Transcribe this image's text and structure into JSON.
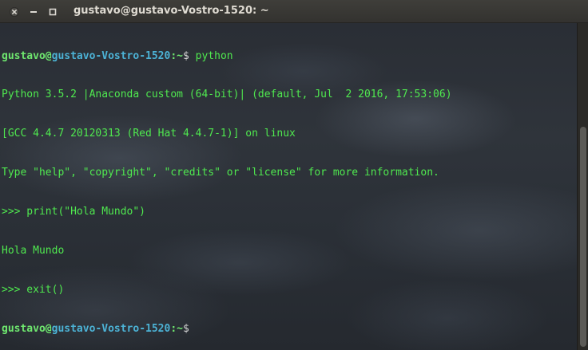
{
  "window": {
    "title": "gustavo@gustavo-Vostro-1520: ~"
  },
  "icons": {
    "close": "close-icon",
    "minimize": "minimize-icon",
    "maximize": "maximize-icon"
  },
  "colors": {
    "output_green": "#4fe84f",
    "prompt_green": "#6fe86f",
    "prompt_host_blue": "#4cb3d6",
    "titlebar_bg": "#3c3b37"
  },
  "terminal": {
    "prompt1": {
      "user": "gustavo",
      "at": "@",
      "host": "gustavo-Vostro-1520",
      "path": ":~",
      "dollar": "$",
      "command": " python"
    },
    "output": [
      "Python 3.5.2 |Anaconda custom (64-bit)| (default, Jul  2 2016, 17:53:06)",
      "[GCC 4.4.7 20120313 (Red Hat 4.4.7-1)] on linux",
      "Type \"help\", \"copyright\", \"credits\" or \"license\" for more information.",
      ">>> print(\"Hola Mundo\")",
      "Hola Mundo",
      ">>> exit()"
    ],
    "prompt2": {
      "user": "gustavo",
      "at": "@",
      "host": "gustavo-Vostro-1520",
      "path": ":~",
      "dollar": "$"
    }
  }
}
